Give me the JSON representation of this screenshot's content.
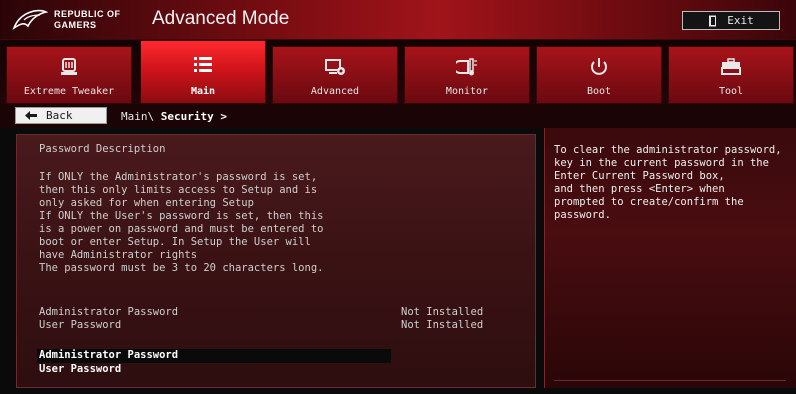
{
  "header": {
    "logo_line1": "REPUBLIC OF",
    "logo_line2": "GAMERS",
    "title": "Advanced Mode",
    "exit_label": "Exit"
  },
  "tabs": [
    {
      "label": "Extreme Tweaker",
      "icon": "cpu-cooler-icon",
      "active": false
    },
    {
      "label": "Main",
      "icon": "list-icon",
      "active": true
    },
    {
      "label": "Advanced",
      "icon": "settings-chip-icon",
      "active": false
    },
    {
      "label": "Monitor",
      "icon": "thermometer-icon",
      "active": false
    },
    {
      "label": "Boot",
      "icon": "power-icon",
      "active": false
    },
    {
      "label": "Tool",
      "icon": "toolbox-icon",
      "active": false
    }
  ],
  "breadcrumb": {
    "back_label": "Back",
    "path_prefix": "Main\\ ",
    "path_current": "Security >"
  },
  "main": {
    "description_heading": "Password Description",
    "description_lines": [
      "If ONLY the Administrator's password is set,",
      "then this only limits access to Setup and is",
      "only asked for when entering Setup",
      "If ONLY the User's password is set, then this",
      "is a power on password and must be entered to",
      "boot or enter Setup. In Setup the User will",
      "have Administrator rights",
      "The password must be 3 to 20 characters long."
    ],
    "status_rows": [
      {
        "label": "Administrator Password",
        "value": "Not Installed"
      },
      {
        "label": "User Password",
        "value": "Not Installed"
      }
    ],
    "options": [
      {
        "label": "Administrator Password",
        "selected": true
      },
      {
        "label": "User Password",
        "selected": false
      }
    ]
  },
  "help": {
    "lines": [
      "To clear the administrator password,",
      "key in the current password in the",
      "Enter Current Password box,",
      "and then press <Enter> when",
      "prompted to create/confirm the",
      "password."
    ]
  },
  "colors": {
    "accent": "#d0141a",
    "tab_inactive": "#8a0c12",
    "panel_bg": "#3a1214",
    "selection_bg": "#0a0a0a"
  }
}
